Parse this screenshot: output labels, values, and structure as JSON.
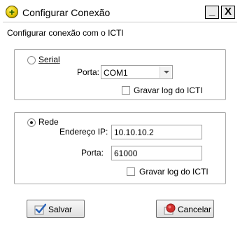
{
  "window": {
    "title": "Configurar Conexão",
    "minimize_label": "_",
    "close_label": "X"
  },
  "header": {
    "subtitle": "Configurar conexão com o ICTI"
  },
  "serial": {
    "option_label": "Serial",
    "selected": false,
    "port_label": "Porta:",
    "port_value": "COM1",
    "log_label": "Gravar log do ICTI",
    "log_checked": false
  },
  "rede": {
    "option_label": "Rede",
    "selected": true,
    "ip_label": "Endereço IP:",
    "ip_value": "10.10.10.2",
    "port_label": "Porta:",
    "port_value": "61000",
    "log_label": "Gravar log do ICTI",
    "log_checked": false
  },
  "buttons": {
    "save_label": "Salvar",
    "cancel_label": "Cancelar"
  },
  "icons": {
    "app": "plus-circle-icon",
    "save": "checkmark-icon",
    "cancel": "stop-icon"
  },
  "colors": {
    "app_icon": "#e0c000",
    "save_check": "#2a63b8",
    "cancel_icon": "#d0302e"
  }
}
